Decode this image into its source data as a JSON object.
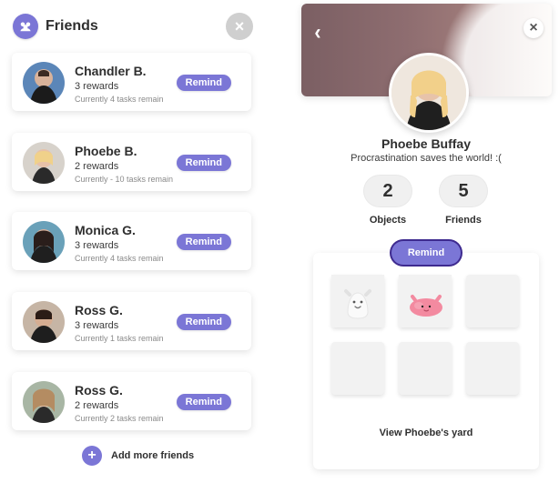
{
  "left": {
    "title": "Friends",
    "friends": [
      {
        "name": "Chandler B.",
        "rewards": "3 rewards",
        "status": "Currently 4 tasks remain",
        "remind": "Remind"
      },
      {
        "name": "Phoebe B.",
        "rewards": "2 rewards",
        "status": "Currently - 10 tasks remain",
        "remind": "Remind"
      },
      {
        "name": "Monica G.",
        "rewards": "3 rewards",
        "status": "Currently 4 tasks remain",
        "remind": "Remind"
      },
      {
        "name": "Ross G.",
        "rewards": "3 rewards",
        "status": "Currently 1 tasks remain",
        "remind": "Remind"
      },
      {
        "name": "Ross G.",
        "rewards": "2 rewards",
        "status": "Currently 2 tasks remain",
        "remind": "Remind"
      }
    ],
    "add_more": "Add more friends"
  },
  "right": {
    "profile_name": "Phoebe Buffay",
    "tagline": "Procrastination saves the world! :(",
    "stats": {
      "objects_value": "2",
      "objects_label": "Objects",
      "friends_value": "5",
      "friends_label": "Friends"
    },
    "remind_button": "Remind",
    "view_yard": "View Phoebe's yard"
  },
  "colors": {
    "accent": "#7b76d6",
    "accent_outline": "#3e2a8f"
  },
  "icons": {
    "friends": "friends-icon",
    "close": "close-icon",
    "back": "chevron-left-icon",
    "add": "plus-icon"
  }
}
